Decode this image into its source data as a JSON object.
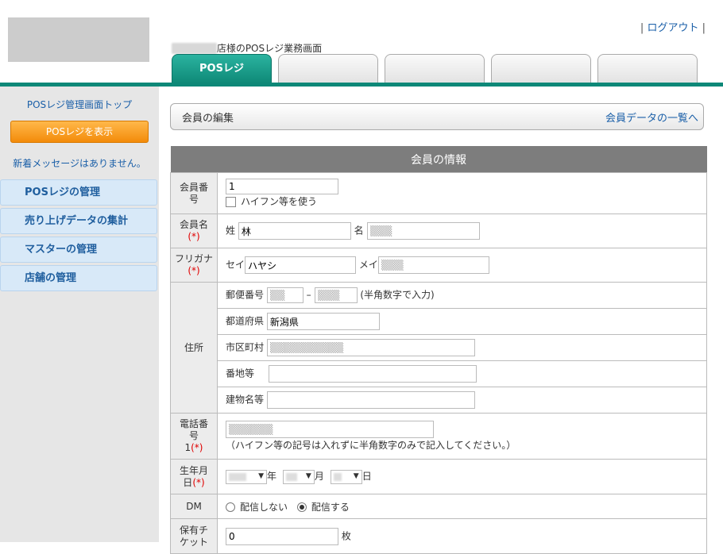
{
  "header": {
    "logout_label": "ログアウト",
    "logout_sep": "|",
    "shop_line_suffix": "店様のPOSレジ業務画面",
    "tabs": [
      "POSレジ",
      "",
      "",
      "",
      ""
    ]
  },
  "sidebar": {
    "top_link": "POSレジ管理画面トップ",
    "pos_button": "POSレジを表示",
    "message": "新着メッセージはありません。",
    "items": [
      "POSレジの管理",
      "売り上げデータの集計",
      "マスターの管理",
      "店舗の管理"
    ]
  },
  "page": {
    "title": "会員の編集",
    "list_link": "会員データの一覧へ",
    "section_title": "会員の情報"
  },
  "form": {
    "member_no": {
      "label1": "会員番",
      "label2": "号",
      "value": "1",
      "hyphen_label": "ハイフン等を使う"
    },
    "name": {
      "label": "会員名",
      "req": "(*)",
      "sei_label": "姓",
      "sei_value": "林",
      "mei_label": "名"
    },
    "kana": {
      "label1": "フリガ",
      "label2": "ナ",
      "req": "(*)",
      "sei_label": "セイ",
      "sei_value": "ハヤシ",
      "mei_label": "メイ"
    },
    "address": {
      "label": "住所",
      "postal_label": "郵便番号",
      "postal_dash": "–",
      "postal_note": "(半角数字で入力)",
      "pref_label": "都道府県",
      "pref_value": "新潟県",
      "city_label": "市区町村",
      "street_label": "番地等",
      "building_label": "建物名等"
    },
    "phone": {
      "label1": "電話番",
      "label2": "号",
      "label3": "1",
      "req": "(*)",
      "note": "（ハイフン等の記号は入れずに半角数字のみで記入してください。）"
    },
    "birth": {
      "label1": "生年月",
      "label2": "日",
      "req": "(*)",
      "year_unit": "年",
      "month_unit": "月",
      "day_unit": "日"
    },
    "dm": {
      "label": "DM",
      "opt_no": "配信しない",
      "opt_yes": "配信する",
      "selected": "yes"
    },
    "ticket": {
      "label1": "保有チ",
      "label2": "ケット",
      "value": "0",
      "unit": "枚"
    }
  }
}
